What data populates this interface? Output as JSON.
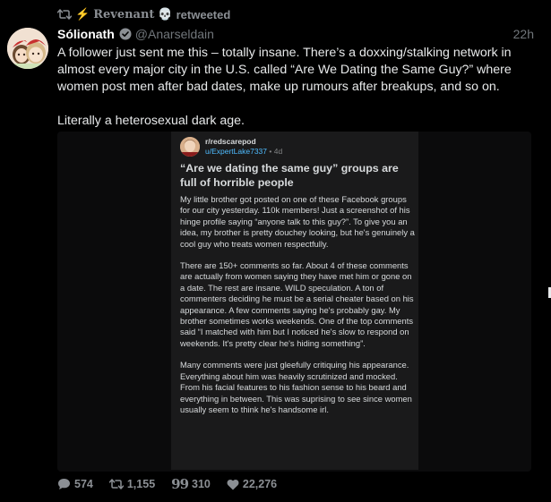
{
  "retweet": {
    "name": "Revenant",
    "label": "retweeted",
    "bolt": "⚡",
    "skull": "💀"
  },
  "author": {
    "display_name": "Sólionath",
    "handle": "@Anarseldain",
    "time": "22h",
    "verified_color": "#8b8f94"
  },
  "tweet": {
    "paragraphs": [
      "A follower just sent me this – totally insane. There’s a doxxing/stalking network in almost every major city in the U.S. called “Are We Dating the Same Guy?” where women post men after bad dates, make up rumours after breakups, and so on.",
      "Literally a heterosexual dark age."
    ]
  },
  "reddit_post": {
    "subreddit": "r/redscarepod",
    "user": "u/ExpertLake7337",
    "age": "4d",
    "title": "“Are we dating the same guy” groups are full of horrible people",
    "body": [
      "My little brother got posted on one of these Facebook groups for our city yesterday. 110k members! Just a screenshot of his hinge profile saying “anyone talk to this guy?”. To give you an idea, my brother is pretty douchey looking, but he's genuinely a cool guy who treats women respectfully.",
      "There are 150+ comments so far. About 4 of these comments are actually from women saying they have met him or gone on a date. The rest are insane. WILD speculation. A ton of commenters deciding he must be a serial cheater based on his appearance. A few comments saying he's probably gay. My brother sometimes works weekends. One of the top comments said “I matched with him but I noticed he's slow to respond on weekends. It's pretty clear he's hiding something”.",
      "Many comments were just gleefully critiquing his appearance. Everything about him was heavily scrutinized and mocked. From his facial features to his fashion sense to his beard and everything in between. This was suprising to see since women usually seem to think he's handsome irl."
    ]
  },
  "actions": {
    "replies": "574",
    "retweets": "1,155",
    "quotes": "310",
    "likes": "22,276",
    "quote_glyph": "99"
  },
  "colors": {
    "background": "#000000",
    "text": "#e7e9ea",
    "muted": "#71767b",
    "reddit_card": "#1a1a1b",
    "reddit_link": "#4fbcff",
    "bolt": "#f6c343"
  }
}
